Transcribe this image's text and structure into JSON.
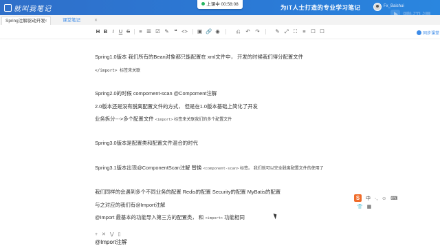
{
  "header": {
    "logo_text": "就叫我笔记",
    "timer_label": "上课中 00:58:08",
    "slogan": "为IT人士打造的专业学习笔记",
    "username": "Fx_Baishui"
  },
  "watermark": {
    "text": "腾讯课堂"
  },
  "tabs": [
    {
      "label": "Spring注解驱动开发"
    },
    {
      "label": "课堂笔记"
    }
  ],
  "share": {
    "label": "同步课堂"
  },
  "toolbar": {
    "items": [
      "H",
      "B",
      "I",
      "U",
      "S",
      "≡",
      "☰",
      "☑",
      "✎",
      "❝",
      "<>",
      "▣",
      "🔗",
      "◉",
      "⎌",
      "↶",
      "↷",
      "✎",
      "⤢",
      "⛶",
      "≡",
      "☐",
      "☐"
    ]
  },
  "content": {
    "lines": [
      {
        "text": "Spring1.0版本 我们所有的Bean对象都只能配置在 xml文件中， 开发的时候我们得分配置文件",
        "style": "normal"
      },
      {
        "text": "</import>  标签来关联",
        "style": "small"
      },
      {
        "text": "Spring2.0的时候  compoment-scan   @Compoment注解",
        "style": "normal"
      },
      {
        "text": "2.0版本还是没有脱离配置文件的方式， 但是在1.0版本基础上简化了开发",
        "style": "normal"
      },
      {
        "text_a": "业务拆分--->多个配置文件 ",
        "code": "<import>",
        "text_b": "  标签来关联我们的多个配置文件",
        "style": "mixed"
      },
      {
        "text": "Spring3.0版本是配置类和配置文件混合的时代",
        "style": "normal"
      },
      {
        "text_a": "Spring3.1版本出现@ComponentScan注解 替换 ",
        "code": "<component-scan>",
        "text_b": " 标签。 我们就可以完全脱离配置文件的使用了",
        "style": "mixed"
      },
      {
        "text": "我们同样的会遇到多个不同业务的配置 Redis的配置  Security的配置 MyBatis的配置",
        "style": "normal"
      },
      {
        "text": "与之对应的我们有@Import注解",
        "style": "normal"
      },
      {
        "text_a": "@Import 最基本的功能导入第三方的配置类， 和 ",
        "code": "<import>",
        "text_b": " 功能相同",
        "style": "mixed"
      },
      {
        "text": "@Import注解",
        "style": "normal"
      }
    ]
  },
  "ime": {
    "logo": "S",
    "items": [
      "中",
      "·,",
      "☺",
      "⌨",
      "👕",
      "▦"
    ]
  },
  "minibar": {
    "text": "+ ✕ ⋁ ▯"
  },
  "colors": {
    "header_bg": "#2b7ad6",
    "accent": "#3c8be8",
    "ime_logo": "#f06c2a"
  }
}
